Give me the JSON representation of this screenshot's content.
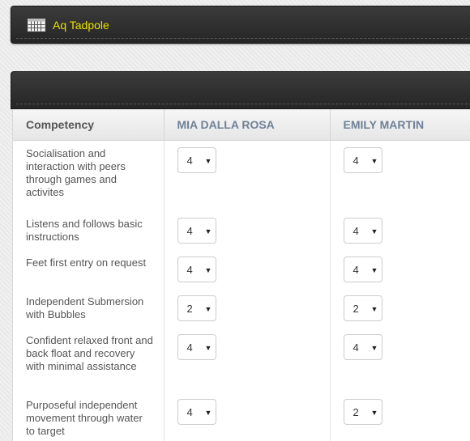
{
  "header": {
    "title": "Aq Tadpole",
    "icon": "calendar-grid-icon"
  },
  "table": {
    "columns": [
      "Competency",
      "MIA DALLA ROSA",
      "EMILY MARTIN"
    ],
    "rows": [
      {
        "competency": "Socialisation and interaction with peers through games and activites",
        "mia": "4",
        "emily": "4"
      },
      {
        "competency": "Listens and follows basic instructions",
        "mia": "4",
        "emily": "4"
      },
      {
        "competency": "Feet first entry on request",
        "mia": "4",
        "emily": "4"
      },
      {
        "competency": "Independent Submersion with Bubbles",
        "mia": "2",
        "emily": "2"
      },
      {
        "competency": "Confident relaxed front and back float and recovery with minimal assistance",
        "mia": "4",
        "emily": "4"
      },
      {
        "competency": "Purposeful independent movement through water to target",
        "mia": "4",
        "emily": "2"
      }
    ]
  },
  "colors": {
    "title": "#e8e300",
    "bar": "#2e2e2e",
    "student_header": "#6f8196"
  }
}
